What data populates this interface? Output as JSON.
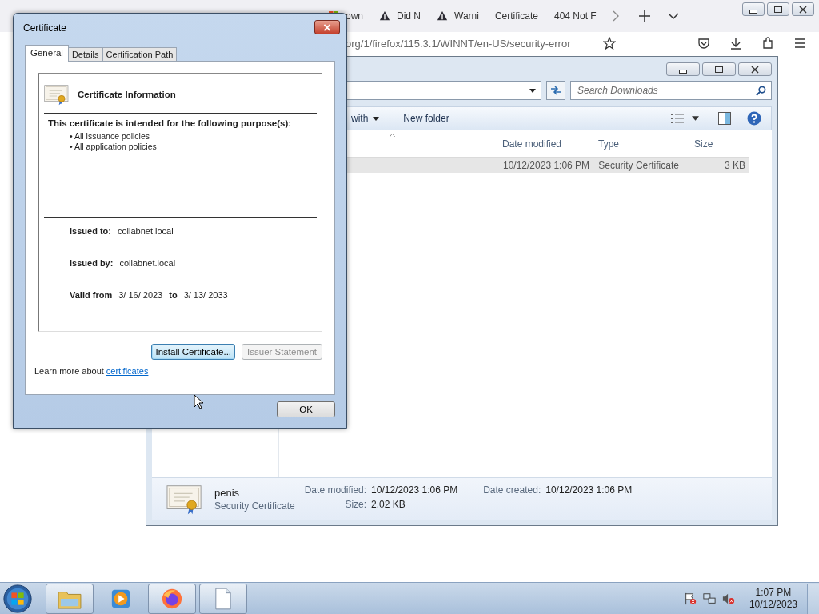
{
  "browser": {
    "tabs": [
      {
        "label": "own",
        "kind": "windows",
        "selected": false
      },
      {
        "label": "Did N",
        "kind": "warning",
        "selected": false
      },
      {
        "label": "Warni",
        "kind": "warning",
        "selected": false
      },
      {
        "label": "Certificate",
        "kind": "plain",
        "selected": false
      },
      {
        "label": "404 Not F",
        "kind": "plain",
        "selected": false
      }
    ],
    "url": "org/1/firefox/115.3.1/WINNT/en-US/security-error"
  },
  "explorer": {
    "search": {
      "placeholder": "Search Downloads"
    },
    "toolbar": [
      {
        "label": "with",
        "has_menu": true
      },
      {
        "label": "New folder",
        "has_menu": false
      }
    ],
    "columns": [
      "Date modified",
      "Type",
      "Size"
    ],
    "rows": [
      {
        "date": "10/12/2023 1:06 PM",
        "type": "Security Certificate",
        "size": "3 KB",
        "selected": true
      }
    ],
    "details": {
      "name": "penis",
      "type": "Security Certificate",
      "fields": [
        {
          "label": "Date modified:",
          "value": "10/12/2023 1:06 PM"
        },
        {
          "label": "Size:",
          "value": "2.02 KB"
        },
        {
          "label": "Date created:",
          "value": "10/12/2023 1:06 PM"
        }
      ]
    }
  },
  "dialog": {
    "title": "Certificate",
    "tabs": [
      {
        "label": "General",
        "selected": true
      },
      {
        "label": "Details",
        "selected": false
      },
      {
        "label": "Certification Path",
        "selected": false
      }
    ],
    "heading": "Certificate Information",
    "purpose_heading": "This certificate is intended for the following purpose(s):",
    "purposes": [
      "• All issuance policies",
      "• All application policies"
    ],
    "fields": [
      {
        "label": "Issued to:",
        "value": "collabnet.local"
      },
      {
        "label": "Issued by:",
        "value": "collabnet.local"
      }
    ],
    "validity": {
      "label": "Valid from",
      "from": "3/ 16/ 2023",
      "to_label": "to",
      "to": "3/ 13/ 2033"
    },
    "buttons": [
      {
        "label": "Install Certificate...",
        "disabled": false,
        "focused": true
      },
      {
        "label": "Issuer Statement",
        "disabled": true,
        "focused": false
      }
    ],
    "learn_more": {
      "text": "Learn more about",
      "link": "certificates"
    },
    "ok": "OK"
  },
  "taskbar": {
    "apps": [
      {
        "kind": "folder",
        "running": true
      },
      {
        "kind": "media",
        "running": false
      },
      {
        "kind": "firefox",
        "running": true
      },
      {
        "kind": "document",
        "running": true
      }
    ],
    "time": "1:07 PM",
    "date": "10/12/2023"
  }
}
